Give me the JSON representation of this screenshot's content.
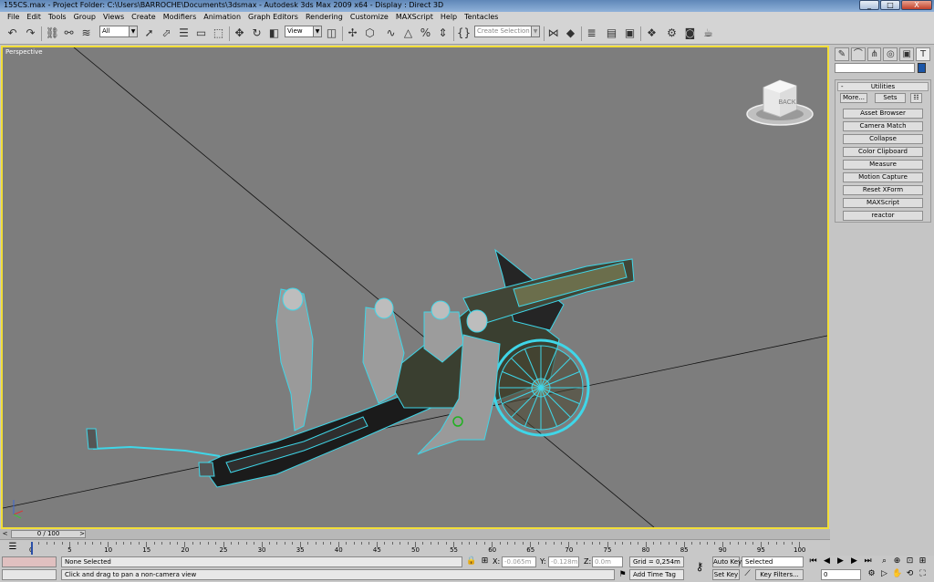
{
  "window": {
    "title": "155CS.max    - Project Folder: C:\\Users\\BARROCHE\\Documents\\3dsmax    - Autodesk 3ds Max  2009 x64      - Display : Direct 3D",
    "min": "_",
    "max": "□",
    "close": "X"
  },
  "menu": [
    "File",
    "Edit",
    "Tools",
    "Group",
    "Views",
    "Create",
    "Modifiers",
    "Animation",
    "Graph Editors",
    "Rendering",
    "Customize",
    "MAXScript",
    "Help",
    "Tentacles"
  ],
  "toolbar": {
    "selection_filter": "All",
    "ref_coord": "View",
    "named_selection": "Create Selection Set"
  },
  "viewport": {
    "label": "Perspective",
    "viewcube_face": "BACK",
    "background": "#7d7d7d",
    "border": "#f1dd38",
    "wire_color": "#3fd6e8"
  },
  "command_panel": {
    "rollout_title": "Utilities",
    "rollout_toggle": "-",
    "more_label": "More...",
    "sets_label": "Sets",
    "utilities": [
      "Asset Browser",
      "Camera Match",
      "Collapse",
      "Color Clipboard",
      "Measure",
      "Motion Capture",
      "Reset XForm",
      "MAXScript",
      "reactor"
    ],
    "object_color": "#1b56a8"
  },
  "time_slider": {
    "position": "0 / 100",
    "prev": "<",
    "next": ">"
  },
  "trackbar": {
    "labels": [
      "0",
      "5",
      "10",
      "15",
      "20",
      "25",
      "30",
      "35",
      "40",
      "45",
      "50",
      "55",
      "60",
      "65",
      "70",
      "75",
      "80",
      "85",
      "90",
      "95",
      "100"
    ]
  },
  "status": {
    "selection": "None Selected",
    "prompt": "Click and drag to pan a non-camera view",
    "x_label": "X:",
    "x_value": "-0.065m",
    "y_label": "Y:",
    "y_value": "-0.128m",
    "z_label": "Z:",
    "z_value": "0.0m",
    "grid": "Grid = 0,254m",
    "add_time_tag": "Add Time Tag",
    "auto_key": "Auto Key",
    "set_key": "Set Key",
    "key_mode": "Selected",
    "key_filters": "Key Filters...",
    "frame": "0"
  }
}
